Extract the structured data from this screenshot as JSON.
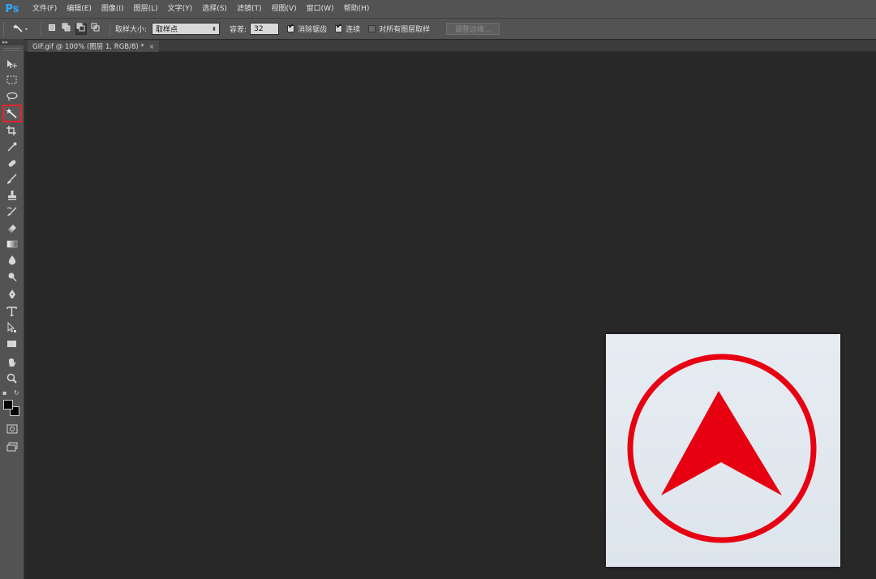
{
  "app": {
    "logo": "Ps",
    "menu": [
      "文件(F)",
      "编辑(E)",
      "图像(I)",
      "图层(L)",
      "文字(Y)",
      "选择(S)",
      "滤镜(T)",
      "视图(V)",
      "窗口(W)",
      "帮助(H)"
    ]
  },
  "options": {
    "sample_size_label": "取样大小:",
    "sample_size_value": "取样点",
    "tolerance_label": "容差:",
    "tolerance_value": "32",
    "anti_alias_label": "消除锯齿",
    "anti_alias_checked": true,
    "contiguous_label": "连续",
    "contiguous_checked": true,
    "sample_all_layers_label": "对所有图层取样",
    "sample_all_layers_checked": false,
    "refine_edge_label": "调整边缘..."
  },
  "document": {
    "tab_title": "GIF.gif @ 100% (图层 1, RGB/8) *",
    "close_glyph": "×"
  },
  "toolbox": {
    "collapse_glyph": "▸▸",
    "selected_tool": "magic-wand-tool"
  },
  "colors": {
    "accent_red": "#e5232a",
    "logo_blue": "#31a8ff",
    "icon_red": "#e60012",
    "foreground": "#000000",
    "background": "#000000"
  }
}
